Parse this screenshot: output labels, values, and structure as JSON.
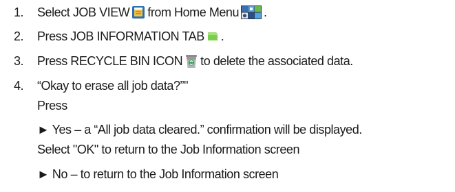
{
  "steps": [
    {
      "number": "1.",
      "text_a": "Select JOB VIEW",
      "icon_a": "job-view-icon",
      "text_b": "from Home Menu",
      "icon_b": "home-menu-icon",
      "text_c": "."
    },
    {
      "number": "2.",
      "text_a": "Press JOB INFORMATION TAB",
      "icon_a": "job-information-tab-icon",
      "text_b": "."
    },
    {
      "number": "3.",
      "text_a": "Press RECYCLE BIN ICON",
      "icon_a": "recycle-bin-icon",
      "text_b": "to delete the associated data."
    },
    {
      "number": "4.",
      "prompt": "“Okay to erase all job data?”\"",
      "press": "Press",
      "yes": "► Yes – a “All job data cleared.” confirmation will be displayed.",
      "ok": "Select \"OK\" to return to the Job Information screen",
      "no": "► No – to return to the Job Information screen"
    }
  ],
  "colors": {
    "text": "#1a1a1a",
    "job_view_icon_border": "#2a6fb5",
    "job_view_icon_fill": "#f0c24a",
    "tab_icon_green": "#7ccf4e",
    "bin_icon_green": "#3fa35a",
    "home_menu_tiles": [
      "#3b6fb0",
      "#5aa0d8",
      "#e6e6e6",
      "#2f4f7a",
      "#6bb84a",
      "#1f3a5c"
    ]
  }
}
